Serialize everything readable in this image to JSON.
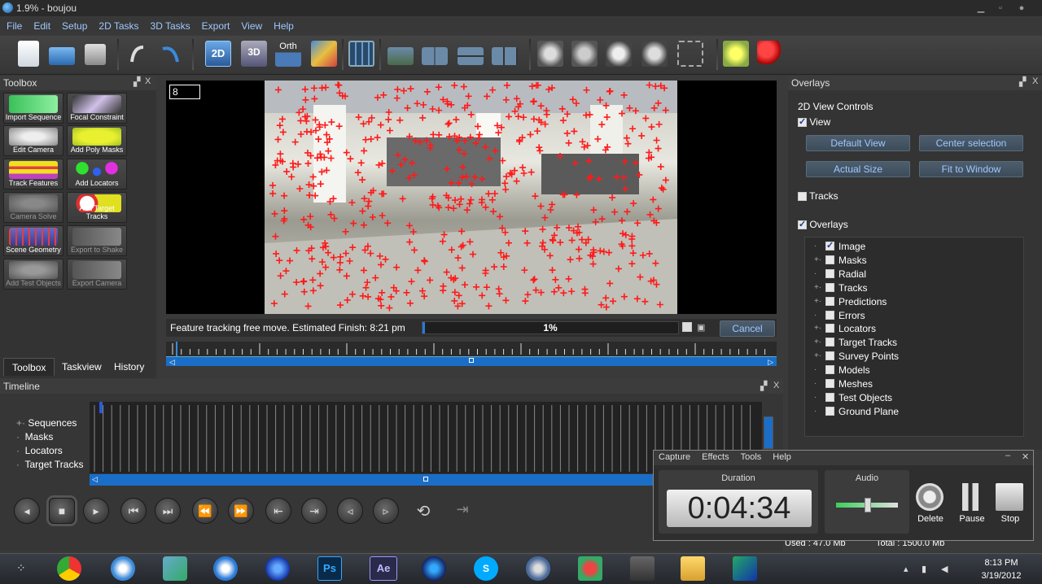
{
  "window": {
    "title": "1.9% - boujou"
  },
  "menu": [
    "File",
    "Edit",
    "Setup",
    "2D Tasks",
    "3D Tasks",
    "Export",
    "View",
    "Help"
  ],
  "toolbar": {
    "view_2d": "2D",
    "view_3d": "3D",
    "view_orth": "Orth"
  },
  "toolbox": {
    "title": "Toolbox",
    "tools": [
      {
        "label": "Import Sequence",
        "enabled": true
      },
      {
        "label": "Focal Constraint",
        "enabled": true
      },
      {
        "label": "Edit Camera",
        "enabled": true
      },
      {
        "label": "Add Poly Masks",
        "enabled": true
      },
      {
        "label": "Track Features",
        "enabled": true
      },
      {
        "label": "Add Locators",
        "enabled": true
      },
      {
        "label": "Camera Solve",
        "enabled": false
      },
      {
        "label": "Add Target Tracks",
        "enabled": true
      },
      {
        "label": "Scene Geometry",
        "enabled": true
      },
      {
        "label": "Export to Shake",
        "enabled": false
      },
      {
        "label": "Add Test Objects",
        "enabled": false
      },
      {
        "label": "Export Camera",
        "enabled": false
      }
    ],
    "tabs": [
      "Toolbox",
      "Taskview",
      "History"
    ]
  },
  "viewport": {
    "frame_number": "8",
    "status": "Feature tracking free move. Estimated Finish: 8:21 pm",
    "progress_percent": 1,
    "progress_label": "1%",
    "cancel_label": "Cancel"
  },
  "timeline": {
    "title": "Timeline",
    "rows": [
      "Sequences",
      "Masks",
      "Locators",
      "Target Tracks"
    ]
  },
  "overlays": {
    "title": "Overlays",
    "section": "2D View Controls",
    "view_label": "View",
    "view_checked": true,
    "buttons": [
      "Default View",
      "Center selection",
      "Actual Size",
      "Fit to Window"
    ],
    "tracks_label": "Tracks",
    "tracks_checked": false,
    "overlays_label": "Overlays",
    "overlays_checked": true,
    "items": [
      {
        "label": "Image",
        "checked": true,
        "expandable": false
      },
      {
        "label": "Masks",
        "checked": false,
        "expandable": true
      },
      {
        "label": "Radial",
        "checked": false,
        "expandable": false
      },
      {
        "label": "Tracks",
        "checked": false,
        "expandable": true
      },
      {
        "label": "Predictions",
        "checked": false,
        "expandable": true
      },
      {
        "label": "Errors",
        "checked": false,
        "expandable": false
      },
      {
        "label": "Locators",
        "checked": false,
        "expandable": true
      },
      {
        "label": "Target Tracks",
        "checked": false,
        "expandable": true
      },
      {
        "label": "Survey Points",
        "checked": false,
        "expandable": true
      },
      {
        "label": "Models",
        "checked": false,
        "expandable": false
      },
      {
        "label": "Meshes",
        "checked": false,
        "expandable": false
      },
      {
        "label": "Test Objects",
        "checked": false,
        "expandable": false
      },
      {
        "label": "Ground Plane",
        "checked": false,
        "expandable": false
      }
    ]
  },
  "memory": {
    "used": "Used : 47.0 Mb",
    "total": "Total : 1500.0 Mb"
  },
  "recorder": {
    "menu": [
      "Capture",
      "Effects",
      "Tools",
      "Help"
    ],
    "duration_label": "Duration",
    "duration": "0:04:34",
    "audio_label": "Audio",
    "audio_level": 0.5,
    "delete_label": "Delete",
    "pause_label": "Pause",
    "stop_label": "Stop"
  },
  "taskbar": {
    "time": "8:13 PM",
    "date": "3/19/2012"
  },
  "colors": {
    "accent_blue": "#1a6ec8",
    "track_red": "#ff2020",
    "link_blue": "#9fc8ff"
  }
}
